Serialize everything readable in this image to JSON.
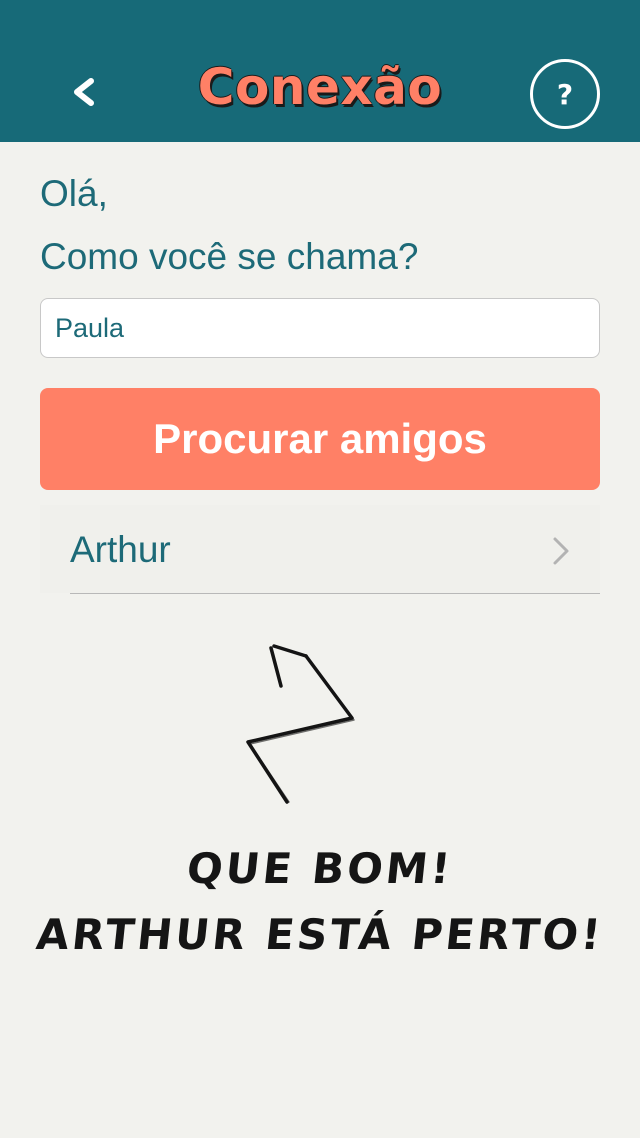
{
  "header": {
    "title": "Conexão",
    "back_icon": "chevron-left-icon",
    "help_label": "?",
    "colors": {
      "bar": "#176a78",
      "title": "#ff8066"
    }
  },
  "main": {
    "greeting": "Olá,",
    "question": "Como você se chama?",
    "name_input": {
      "value": "Paula",
      "placeholder": ""
    },
    "search_button_label": "Procurar amigos",
    "friends": [
      {
        "name": "Arthur",
        "icon": "chevron-right-icon"
      }
    ],
    "illustration_icon": "zigzag-arrow-icon",
    "message_line1": "QUE BOM!",
    "message_line2": "ARTHUR ESTÁ PERTO!"
  },
  "colors": {
    "background": "#f2f2ee",
    "text": "#1d6a78",
    "accent": "#ff8066"
  }
}
